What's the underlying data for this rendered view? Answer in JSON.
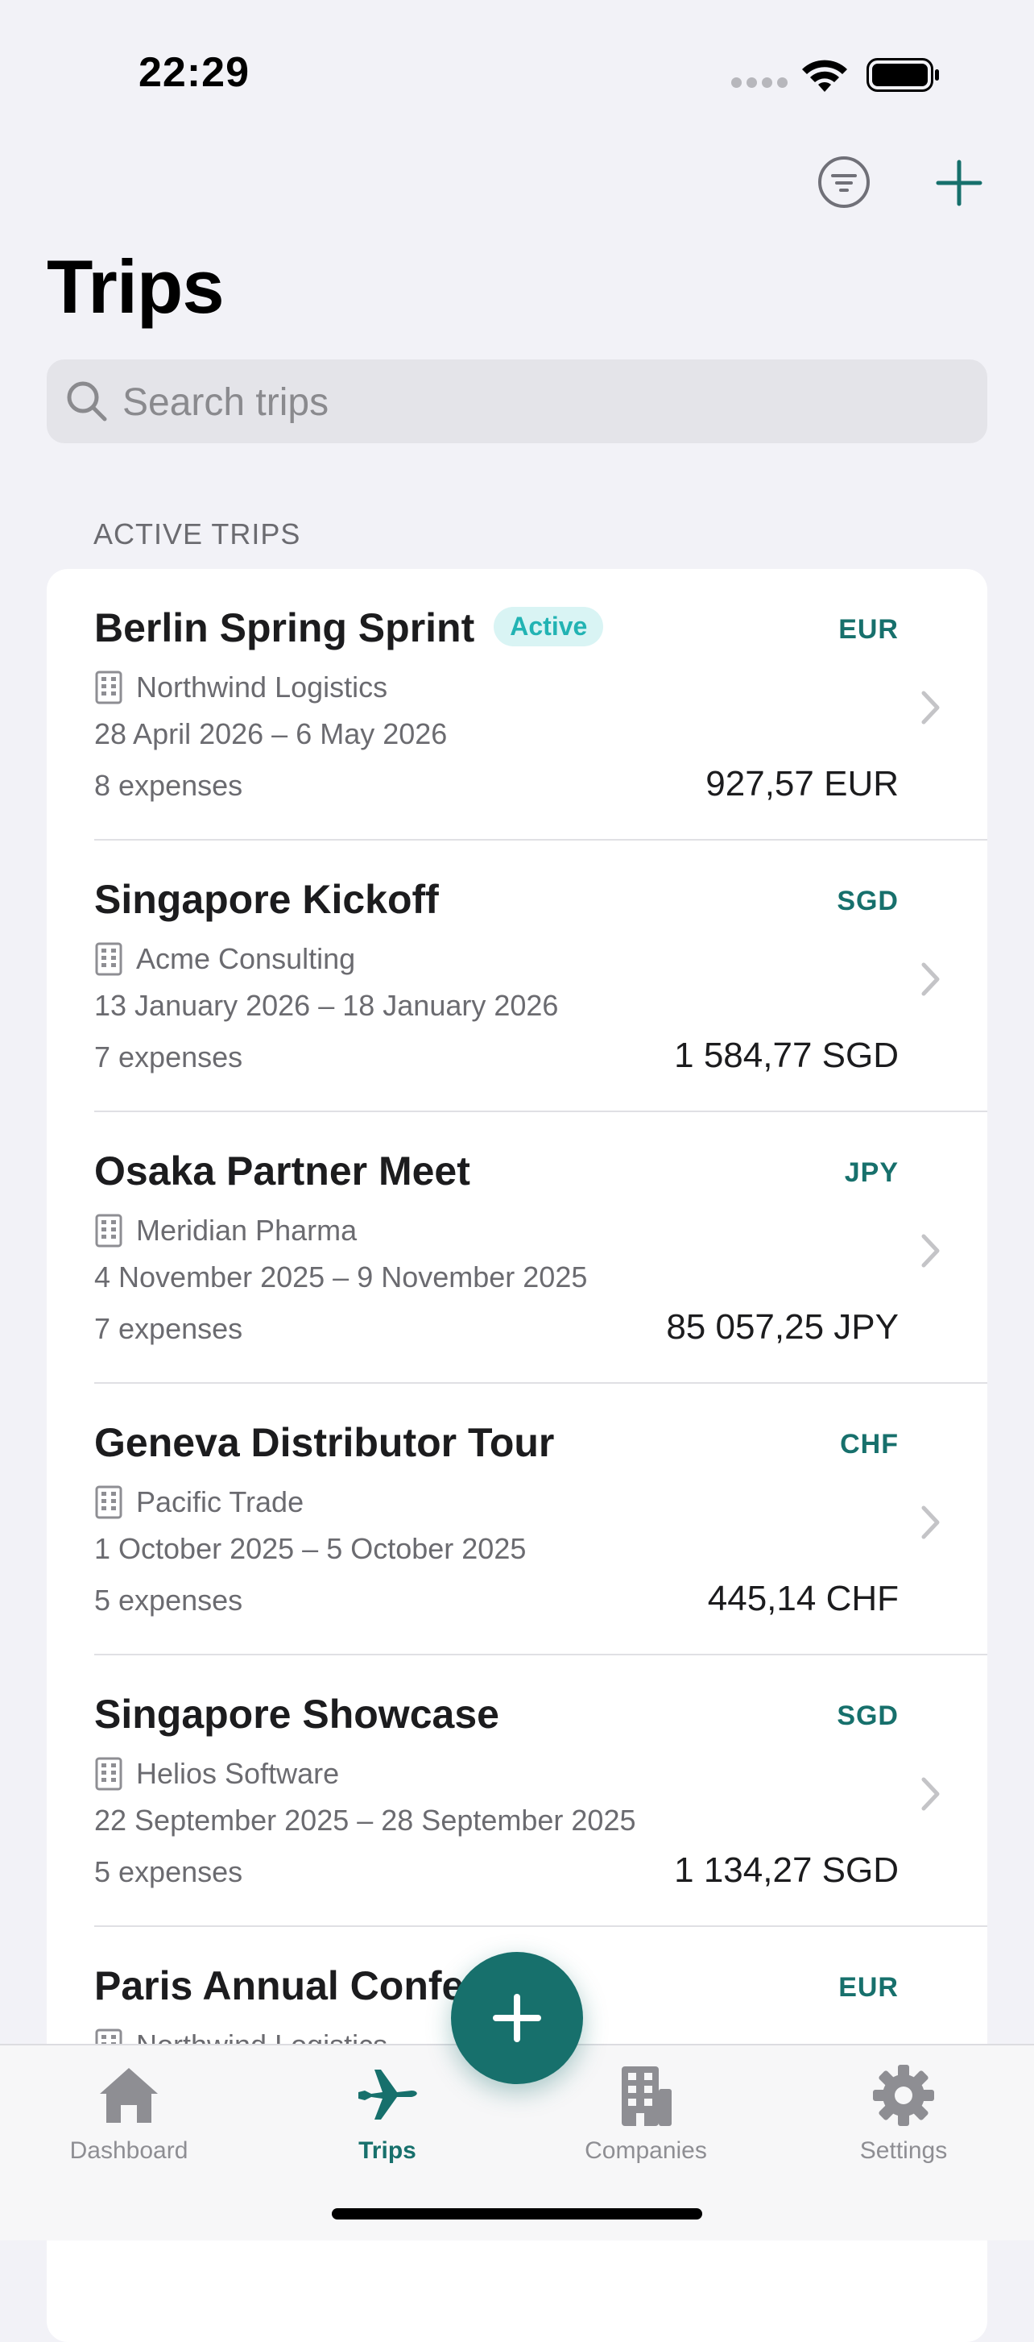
{
  "status_bar": {
    "time": "22:29"
  },
  "header": {
    "title": "Trips"
  },
  "search": {
    "placeholder": "Search trips"
  },
  "section": {
    "title": "ACTIVE TRIPS"
  },
  "trips": [
    {
      "name": "Berlin Spring Sprint",
      "badge": "Active",
      "currency": "EUR",
      "company": "Northwind Logistics",
      "dates": "28 April 2026 – 6 May 2026",
      "expenses": "8 expenses",
      "total": "927,57 EUR"
    },
    {
      "name": "Singapore Kickoff",
      "badge": "",
      "currency": "SGD",
      "company": "Acme Consulting",
      "dates": "13 January 2026 – 18 January 2026",
      "expenses": "7 expenses",
      "total": "1 584,77 SGD"
    },
    {
      "name": "Osaka Partner Meet",
      "badge": "",
      "currency": "JPY",
      "company": "Meridian Pharma",
      "dates": "4 November 2025 – 9 November 2025",
      "expenses": "7 expenses",
      "total": "85 057,25 JPY"
    },
    {
      "name": "Geneva Distributor Tour",
      "badge": "",
      "currency": "CHF",
      "company": "Pacific Trade",
      "dates": "1 October 2025 – 5 October 2025",
      "expenses": "5 expenses",
      "total": "445,14 CHF"
    },
    {
      "name": "Singapore Showcase",
      "badge": "",
      "currency": "SGD",
      "company": "Helios Software",
      "dates": "22 September 2025 – 28 September 2025",
      "expenses": "5 expenses",
      "total": "1 134,27 SGD"
    },
    {
      "name": "Paris Annual Confer",
      "badge": "",
      "currency": "EUR",
      "company": "Northwind Logistics",
      "dates": "",
      "expenses": "",
      "total": ""
    }
  ],
  "tab_bar": {
    "tabs": [
      {
        "label": "Dashboard",
        "icon": "house-icon",
        "active": false
      },
      {
        "label": "Trips",
        "icon": "airplane-icon",
        "active": true
      },
      {
        "label": "Companies",
        "icon": "building-icon",
        "active": false
      },
      {
        "label": "Settings",
        "icon": "gear-icon",
        "active": false
      }
    ]
  },
  "colors": {
    "accent": "#17706c",
    "badge_bg": "#d9f4f4",
    "badge_text": "#22b3b3",
    "background": "#f2f2f7"
  }
}
